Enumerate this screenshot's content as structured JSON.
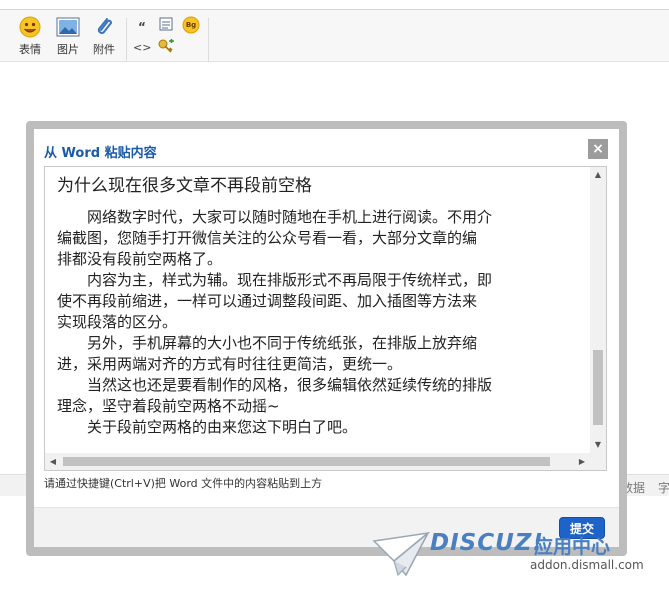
{
  "toolbar": {
    "emoji_label": "表情",
    "image_label": "图片",
    "attachment_label": "附件",
    "quote_glyph": "“",
    "code_glyph": "<>",
    "bg_label": "Bg"
  },
  "background": {
    "strip_right_1": "数据",
    "strip_right_2": "字"
  },
  "dialog": {
    "title": "从 Word 粘贴内容",
    "close_glyph": "×",
    "article_title": "为什么现在很多文章不再段前空格",
    "lines": [
      "　　网络数字时代，大家可以随时随地在手机上进行阅读。不用介",
      "编截图，您随手打开微信关注的公众号看一看，大部分文章的编",
      "排都没有段前空两格了。",
      "　　内容为主，样式为辅。现在排版形式不再局限于传统样式，即",
      "使不再段前缩进，一样可以通过调整段间距、加入插图等方法来",
      "实现段落的区分。",
      "　　另外，手机屏幕的大小也不同于传统纸张，在排版上放弃缩",
      "进，采用两端对齐的方式有时往往更简洁，更统一。",
      "　　当然这也还是要看制作的风格，很多编辑依然延续传统的排版",
      "理念，坚守着段前空两格不动摇~",
      "　　关于段前空两格的由来您这下明白了吧。"
    ],
    "hint": "请通过快捷键(Ctrl+V)把 Word 文件中的内容粘贴到上方",
    "submit_label": "提交"
  },
  "watermark": {
    "brand": "DISCUZ!",
    "sub": "应用中心",
    "url": "addon.dismall.com"
  },
  "colors": {
    "accent": "#1e64c8",
    "title_blue": "#1a5aa8",
    "dialog_border": "#bdbdbd"
  }
}
